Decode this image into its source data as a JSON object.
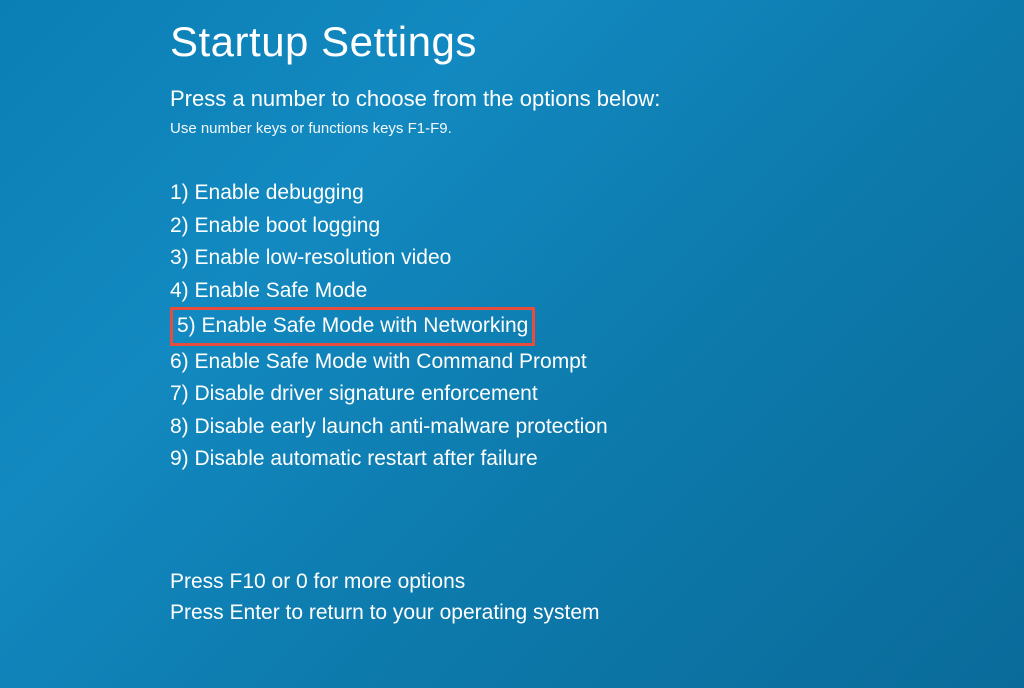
{
  "title": "Startup Settings",
  "subtitle": "Press a number to choose from the options below:",
  "hint": "Use number keys or functions keys F1-F9.",
  "options": [
    {
      "num": "1",
      "label": "Enable debugging",
      "highlighted": false
    },
    {
      "num": "2",
      "label": "Enable boot logging",
      "highlighted": false
    },
    {
      "num": "3",
      "label": "Enable low-resolution video",
      "highlighted": false
    },
    {
      "num": "4",
      "label": "Enable Safe Mode",
      "highlighted": false
    },
    {
      "num": "5",
      "label": "Enable Safe Mode with Networking",
      "highlighted": true
    },
    {
      "num": "6",
      "label": "Enable Safe Mode with Command Prompt",
      "highlighted": false
    },
    {
      "num": "7",
      "label": "Disable driver signature enforcement",
      "highlighted": false
    },
    {
      "num": "8",
      "label": "Disable early launch anti-malware protection",
      "highlighted": false
    },
    {
      "num": "9",
      "label": "Disable automatic restart after failure",
      "highlighted": false
    }
  ],
  "footer": {
    "more_options": "Press F10 or 0 for more options",
    "return": "Press Enter to return to your operating system"
  }
}
